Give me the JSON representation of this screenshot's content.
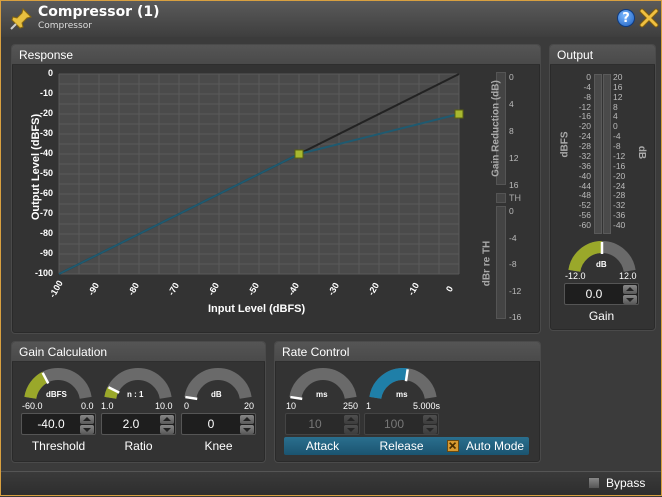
{
  "window": {
    "title": "Compressor (1)",
    "subtitle": "Compressor",
    "help": "?"
  },
  "response": {
    "title": "Response",
    "x_label": "Input Level (dBFS)",
    "y_label": "Output Level (dBFS)",
    "x_ticks": [
      "-100",
      "-90",
      "-80",
      "-70",
      "-60",
      "-50",
      "-40",
      "-30",
      "-20",
      "-10",
      "0"
    ],
    "y_ticks": [
      "0",
      "-10",
      "-20",
      "-30",
      "-40",
      "-50",
      "-60",
      "-70",
      "-80",
      "-90",
      "-100"
    ],
    "gr_label": "Gain Reduction (dB)",
    "gr_ticks": [
      "0",
      "4",
      "8",
      "12",
      "16"
    ],
    "th_label": "TH",
    "dbr_label": "dBr re TH",
    "dbr_ticks": [
      "0",
      "-4",
      "-8",
      "-12",
      "-16"
    ]
  },
  "chart_data": {
    "type": "line",
    "xlabel": "Input Level (dBFS)",
    "ylabel": "Output Level (dBFS)",
    "xlim": [
      -100,
      0
    ],
    "ylim": [
      -100,
      0
    ],
    "grid": true,
    "series": [
      {
        "x": [
          -100,
          0
        ],
        "y": [
          -100,
          0
        ],
        "color": "#222222"
      },
      {
        "x": [
          -100,
          -40,
          0
        ],
        "y": [
          -100,
          -40,
          -20
        ],
        "color": "#1f5a70"
      }
    ],
    "handles": [
      {
        "x": -40,
        "y": -40
      },
      {
        "x": 0,
        "y": -20
      }
    ]
  },
  "output": {
    "title": "Output",
    "dbfs_label": "dBFS",
    "db_label": "dB",
    "dbfs_ticks": [
      "0",
      "-4",
      "-8",
      "-12",
      "-16",
      "-20",
      "-24",
      "-28",
      "-32",
      "-36",
      "-40",
      "-44",
      "-48",
      "-52",
      "-56",
      "-60"
    ],
    "db_ticks": [
      "20",
      "16",
      "12",
      "8",
      "4",
      "0",
      "-4",
      "-8",
      "-12",
      "-16",
      "-20",
      "-24",
      "-28",
      "-32",
      "-36",
      "-40"
    ],
    "gain": {
      "unit": "dB",
      "min": "-12.0",
      "max": "12.0",
      "value": "0.0",
      "label": "Gain",
      "level": 0.5
    }
  },
  "gain_calc": {
    "title": "Gain Calculation",
    "threshold": {
      "unit": "dBFS",
      "min": "-60.0",
      "max": "0.0",
      "value": "-40.0",
      "label": "Threshold",
      "level": 0.33
    },
    "ratio": {
      "unit": "n : 1",
      "min": "1.0",
      "max": "10.0",
      "value": "2.0",
      "label": "Ratio",
      "level": 0.11
    },
    "knee": {
      "unit": "dB",
      "min": "0",
      "max": "20",
      "value": "0",
      "label": "Knee",
      "level": 0.0
    }
  },
  "rate": {
    "title": "Rate Control",
    "attack": {
      "unit": "ms",
      "min": "10",
      "max": "250",
      "value": "10",
      "label": "Attack",
      "level": 0.0
    },
    "release": {
      "unit": "ms",
      "min": "1",
      "max": "5.000s",
      "value": "100",
      "label": "Release",
      "level": 0.55
    },
    "auto_mode": "Auto Mode",
    "auto_checked": true
  },
  "footer": {
    "bypass": "Bypass",
    "bypass_checked": false
  },
  "colors": {
    "accent": "#9aa82a",
    "curve": "#1f5a70",
    "knob_active": "#1f7fa8",
    "border": "#d8a040"
  }
}
